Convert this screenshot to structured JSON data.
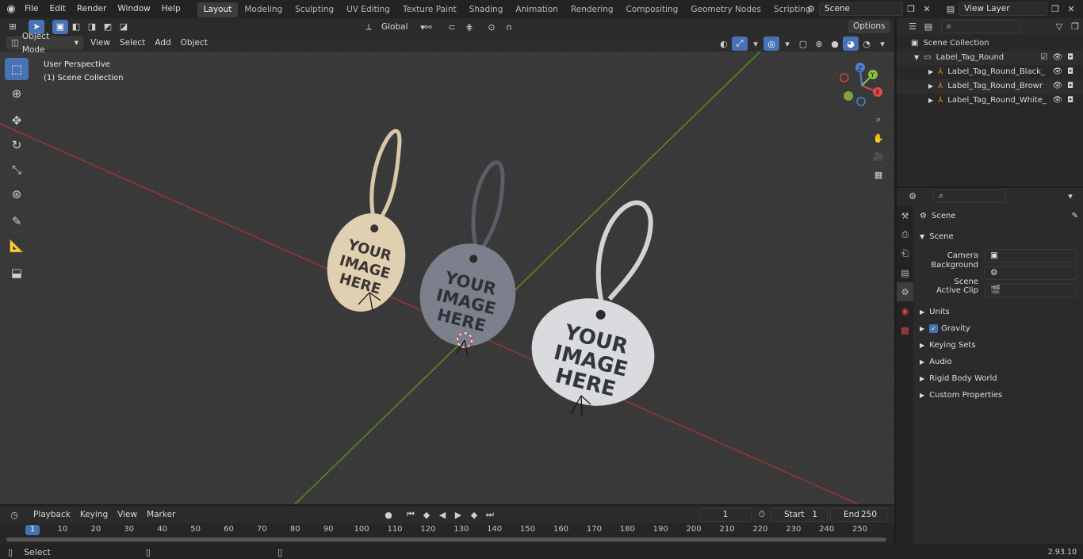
{
  "menu": [
    "File",
    "Edit",
    "Render",
    "Window",
    "Help"
  ],
  "workspaces": [
    "Layout",
    "Modeling",
    "Sculpting",
    "UV Editing",
    "Texture Paint",
    "Shading",
    "Animation",
    "Rendering",
    "Compositing",
    "Geometry Nodes",
    "Scripting"
  ],
  "scene_field": "Scene",
  "view_layer_field": "View Layer",
  "viewport": {
    "mode": "Object Mode",
    "menus": [
      "View",
      "Select",
      "Add",
      "Object"
    ],
    "transform": "Global",
    "options": "Options",
    "overlay_line1": "User Perspective",
    "overlay_line2": "(1) Scene Collection",
    "tag_text": "YOUR IMAGE HERE"
  },
  "outliner": {
    "root": "Scene Collection",
    "collection": "Label_Tag_Round",
    "objects": [
      "Label_Tag_Round_Black_",
      "Label_Tag_Round_Browr",
      "Label_Tag_Round_White_"
    ]
  },
  "properties": {
    "context": "Scene",
    "panel": "Scene",
    "fields": [
      {
        "label": "Camera"
      },
      {
        "label": "Background Scene"
      },
      {
        "label": "Active Clip"
      }
    ],
    "subpanels": [
      "Units",
      "Gravity",
      "Keying Sets",
      "Audio",
      "Rigid Body World",
      "Custom Properties"
    ]
  },
  "timeline": {
    "menus": [
      "Playback",
      "Keying",
      "View",
      "Marker"
    ],
    "current_frame": "1",
    "start_label": "Start",
    "start": "1",
    "end_label": "End",
    "end": "250",
    "ticks": [
      "1",
      "10",
      "20",
      "30",
      "40",
      "50",
      "60",
      "70",
      "80",
      "90",
      "100",
      "110",
      "120",
      "130",
      "140",
      "150",
      "160",
      "170",
      "180",
      "190",
      "200",
      "210",
      "220",
      "230",
      "240",
      "250"
    ]
  },
  "status": {
    "left": "Select",
    "version": "2.93.10"
  },
  "colors": {
    "accent": "#4772b3",
    "x_axis": "#b33a3a",
    "y_axis": "#6f9a2a",
    "tag_beige": "#e1cfb2",
    "tag_gray": "#7c808c",
    "tag_white": "#d9dbde"
  }
}
